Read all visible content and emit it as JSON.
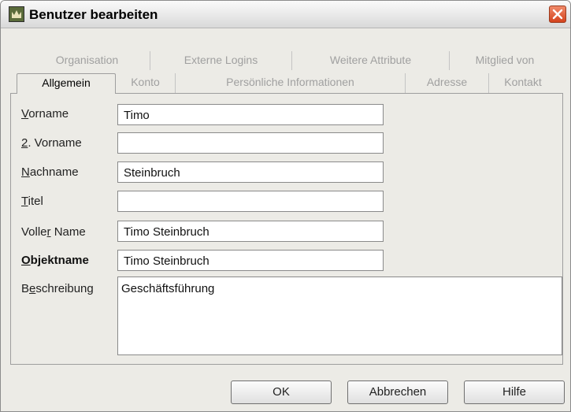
{
  "window": {
    "title": "Benutzer bearbeiten"
  },
  "tabs": {
    "row1": [
      {
        "label": "Organisation"
      },
      {
        "label": "Externe Logins"
      },
      {
        "label": "Weitere Attribute"
      },
      {
        "label": "Mitglied von"
      }
    ],
    "row2": [
      {
        "label": "Allgemein",
        "active": true
      },
      {
        "label": "Konto"
      },
      {
        "label": "Persönliche Informationen"
      },
      {
        "label": "Adresse"
      },
      {
        "label": "Kontakt"
      }
    ]
  },
  "form": {
    "vorname": {
      "label_pre": "",
      "label_mnemonic": "V",
      "label_post": "orname",
      "value": "Timo"
    },
    "zweiter_vorname": {
      "label_pre": "",
      "label_mnemonic": "2",
      "label_post": ". Vorname",
      "value": ""
    },
    "nachname": {
      "label_pre": "",
      "label_mnemonic": "N",
      "label_post": "achname",
      "value": "Steinbruch"
    },
    "titel": {
      "label_pre": "",
      "label_mnemonic": "T",
      "label_post": "itel",
      "value": ""
    },
    "voller_name": {
      "label_pre": "Volle",
      "label_mnemonic": "r",
      "label_post": " Name",
      "value": "Timo Steinbruch"
    },
    "objektname": {
      "label_pre": "",
      "label_mnemonic": "O",
      "label_post": "bjektname",
      "value": "Timo Steinbruch"
    },
    "beschreibung": {
      "label_pre": "B",
      "label_mnemonic": "e",
      "label_post": "schreibung",
      "value": "Geschäftsführung"
    }
  },
  "buttons": {
    "ok": "OK",
    "cancel": "Abbrechen",
    "help": "Hilfe"
  },
  "colors": {
    "window_bg": "#ecebe6",
    "close_button": "#d4421c"
  }
}
